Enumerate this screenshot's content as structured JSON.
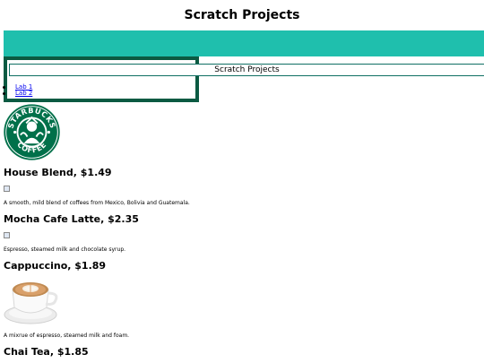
{
  "page": {
    "title": "Scratch Projects"
  },
  "header": {
    "text": "Scratch Projects"
  },
  "nav": {
    "items": [
      {
        "label": "Lab 1"
      },
      {
        "label": "Lab 2"
      }
    ]
  },
  "logo": {
    "icon": "starbucks-logo",
    "wordmark_top": "STARBUCKS",
    "wordmark_bottom": "COFFEE"
  },
  "products": [
    {
      "title": "House Blend, $1.49",
      "description": "A smooth, mild blend of coffees from Mexico, Bolivia and Guatemala.",
      "image": "broken-image-icon"
    },
    {
      "title": "Mocha Cafe Latte, $2.35",
      "description": "Espresso, steamed milk and chocolate syrup.",
      "image": "broken-image-icon"
    },
    {
      "title": "Cappuccino, $1.89",
      "description": "A mixrue of espresso, steamed milk and foam.",
      "image": "cappuccino-cup-photo"
    },
    {
      "title": "Chai Tea, $1.85"
    }
  ],
  "colors": {
    "band": "#1fbfad",
    "nav_border": "#0b5a42",
    "logo_green": "#00704a"
  }
}
